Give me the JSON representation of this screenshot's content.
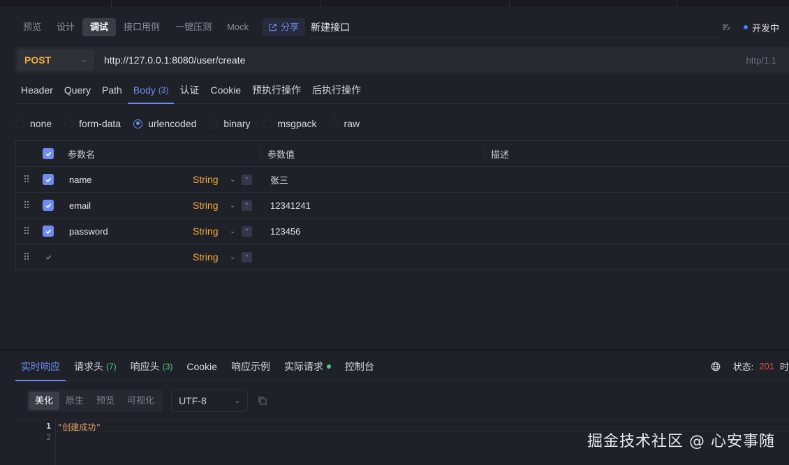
{
  "mode_tabs": [
    "预览",
    "设计",
    "调试",
    "接口用例",
    "一键压测",
    "Mock"
  ],
  "active_mode": "调试",
  "share_label": "分享",
  "api_name": "新建接口",
  "environment": "开发中",
  "request": {
    "method": "POST",
    "url": "http://127.0.0.1:8080/user/create",
    "protocol": "http/1.1"
  },
  "request_tabs": [
    {
      "label": "Header",
      "count": ""
    },
    {
      "label": "Query",
      "count": ""
    },
    {
      "label": "Path",
      "count": ""
    },
    {
      "label": "Body",
      "count": "(3)"
    },
    {
      "label": "认证",
      "count": ""
    },
    {
      "label": "Cookie",
      "count": ""
    },
    {
      "label": "预执行操作",
      "count": ""
    },
    {
      "label": "后执行操作",
      "count": ""
    }
  ],
  "active_request_tab": "Body",
  "body_types": [
    "none",
    "form-data",
    "urlencoded",
    "binary",
    "msgpack",
    "raw"
  ],
  "selected_body_type": "urlencoded",
  "params_table": {
    "headers": {
      "name": "参数名",
      "value": "参数值",
      "description": "描述"
    },
    "rows": [
      {
        "checked": true,
        "name": "name",
        "type": "String",
        "value": "张三",
        "description": ""
      },
      {
        "checked": true,
        "name": "email",
        "type": "String",
        "value": "12341241",
        "description": ""
      },
      {
        "checked": true,
        "name": "password",
        "type": "String",
        "value": "123456",
        "description": ""
      },
      {
        "checked": false,
        "name": "",
        "type": "String",
        "value": "",
        "description": ""
      }
    ]
  },
  "response_tabs": [
    {
      "label": "实时响应",
      "count": "",
      "dot": false
    },
    {
      "label": "请求头",
      "count": "(7)",
      "dot": false
    },
    {
      "label": "响应头",
      "count": "(3)",
      "dot": false
    },
    {
      "label": "Cookie",
      "count": "",
      "dot": false
    },
    {
      "label": "响应示例",
      "count": "",
      "dot": false
    },
    {
      "label": "实际请求",
      "count": "",
      "dot": true
    },
    {
      "label": "控制台",
      "count": "",
      "dot": false
    }
  ],
  "active_response_tab": "实时响应",
  "status": {
    "label": "状态:",
    "code": "201",
    "time_label": "时"
  },
  "view_modes": [
    "美化",
    "原生",
    "预览",
    "可视化"
  ],
  "active_view_mode": "美化",
  "encoding": "UTF-8",
  "response_body": {
    "line_numbers": [
      "1",
      "2"
    ],
    "lines": [
      "\"创建成功\"",
      ""
    ]
  },
  "watermark": "掘金技术社区 @ 心安事随",
  "colors": {
    "accent": "#6f8cf2",
    "method": "#f2a93b",
    "status_code": "#e24d4d",
    "success_dot": "#56c98a",
    "background": "#1f2128"
  }
}
